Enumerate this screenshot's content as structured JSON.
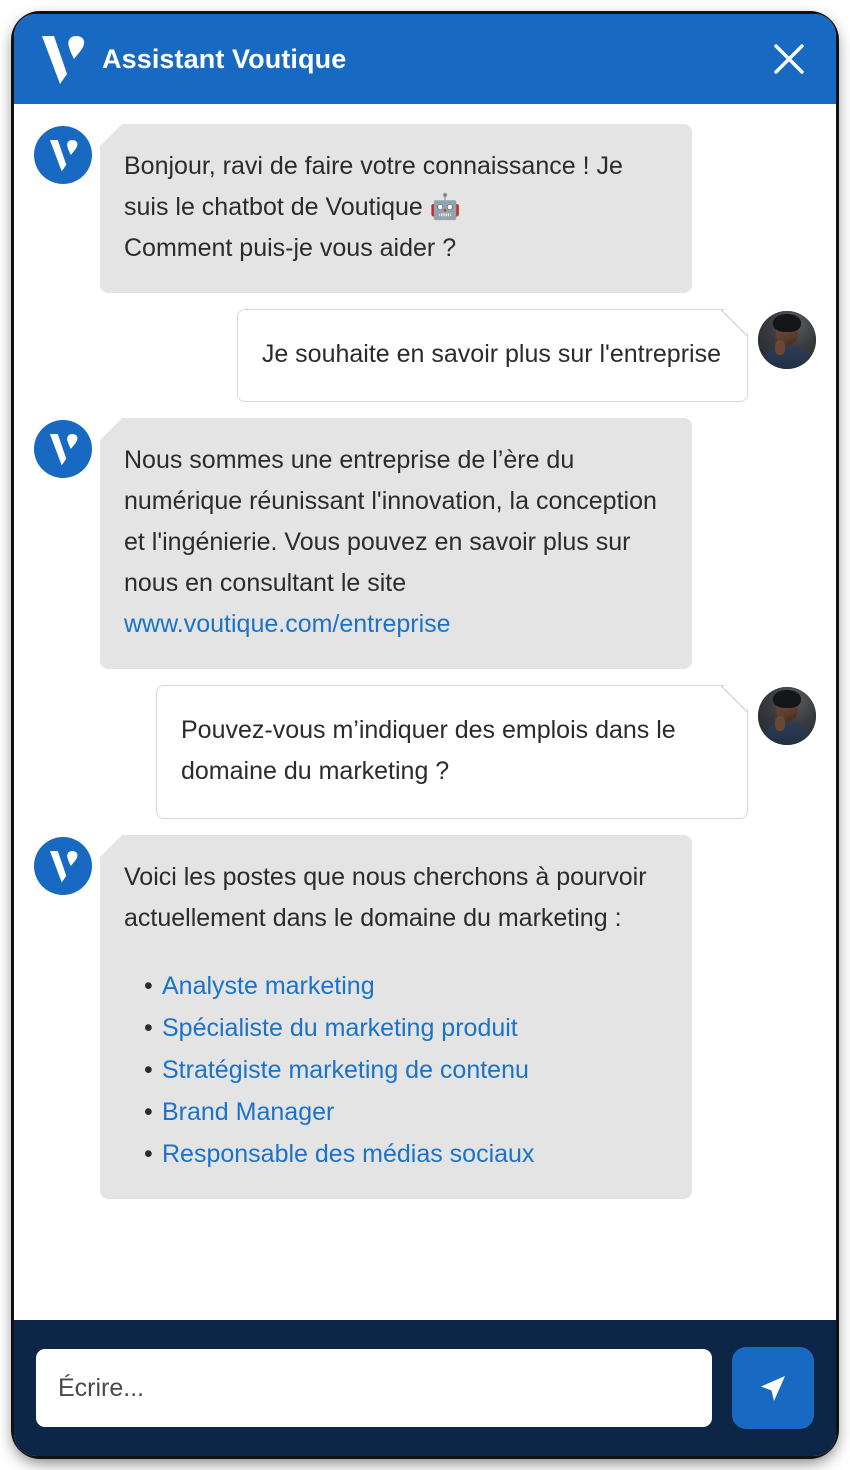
{
  "widget": {
    "header": {
      "logo_icon": "voutique-v-logo-icon",
      "title": "Assistant Voutique",
      "close_icon": "close-icon",
      "background_color": "#1869c2"
    },
    "conversation": {
      "messages": [
        {
          "sender": "bot",
          "avatar_icon": "voutique-bot-avatar-icon",
          "lines": [
            "Bonjour, ravi de faire votre connaissance !  Je suis le chatbot de Voutique 🤖",
            "Comment puis-je vous aider ?"
          ]
        },
        {
          "sender": "user",
          "avatar_icon": "user-photo-avatar",
          "lines": [
            "Je souhaite en savoir plus sur l'entreprise"
          ]
        },
        {
          "sender": "bot",
          "avatar_icon": "voutique-bot-avatar-icon",
          "text_before_link": "Nous sommes une entreprise de l’ère du numérique réunissant l'innovation, la conception et l'ingénierie. Vous pouvez en savoir plus sur nous en consultant le site ",
          "link_text": "www.voutique.com/entreprise"
        },
        {
          "sender": "user",
          "avatar_icon": "user-photo-avatar",
          "lines": [
            "Pouvez-vous m’indiquer des emplois dans le domaine du marketing ?"
          ]
        },
        {
          "sender": "bot",
          "avatar_icon": "voutique-bot-avatar-icon",
          "intro": "Voici les postes que nous cherchons à pourvoir actuellement dans le domaine du marketing :",
          "jobs": [
            "Analyste marketing",
            "Spécialiste du marketing produit",
            "Stratégiste marketing de contenu",
            "Brand Manager",
            "Responsable des médias sociaux"
          ]
        }
      ]
    },
    "composer": {
      "input_value": "",
      "input_placeholder": "Écrire...",
      "send_icon": "send-arrow-icon",
      "background_color": "#0d2546"
    },
    "colors": {
      "brand_blue": "#1869c2",
      "link_blue": "#1a73c9",
      "bot_bubble_gray": "#e4e4e4",
      "footer_navy": "#0d2546",
      "text_dark": "#2b2b2b"
    }
  }
}
